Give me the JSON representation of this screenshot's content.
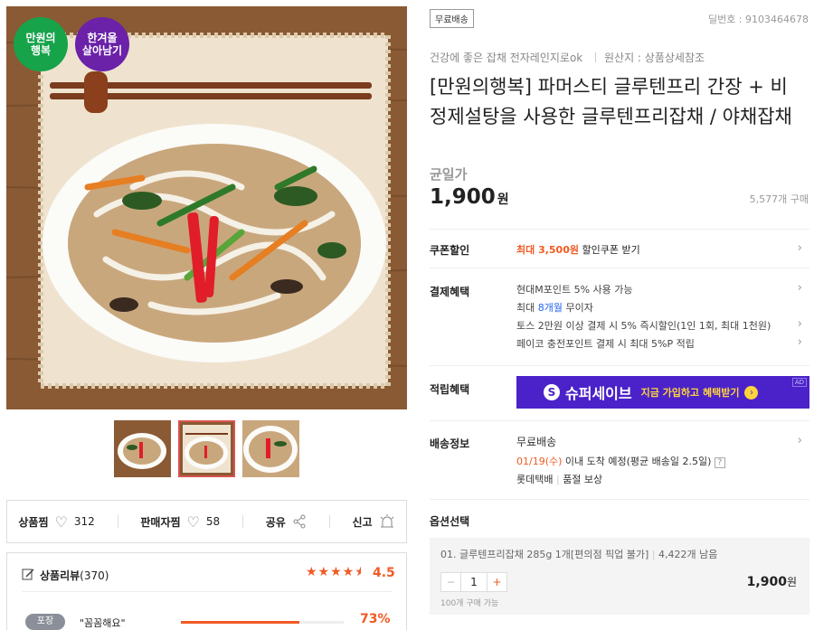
{
  "badges": {
    "happiness": "만원의\n행복",
    "winter": "한겨울\n살아남기"
  },
  "product": {
    "free_ship_tag": "무료배송",
    "product_no": "딜번호 : 9103464678",
    "subtitle": "건강에 좋은 잡채 전자레인지로ok",
    "origin": "원산지 : 상품상세참조",
    "title": "[만원의행복] 파머스티 글루텐프리 간장 + 비정제설탕을 사용한 글루텐프리잡채 / 야채잡채",
    "price_label": "균일가",
    "price": "1,900",
    "price_unit": "원",
    "sold": "5,577개 구매"
  },
  "coupon": {
    "label": "쿠폰할인",
    "highlight": "최대 3,500원",
    "text": "할인쿠폰 받기"
  },
  "payment": {
    "label": "결제혜택",
    "items": [
      {
        "text": "현대M포인트 5% 사용 가능"
      },
      {
        "pre": "최대 ",
        "hl": "8개월",
        "post": " 무이자"
      },
      {
        "text": "토스 2만원 이상 결제 시 5% 즉시할인(1인 1회, 최대 1천원)"
      },
      {
        "text": "페이코 충전포인트 결제 시 최대 5%P 적립"
      }
    ]
  },
  "rewards": {
    "label": "적립혜택",
    "banner_brand": "슈퍼세이브",
    "banner_cta": "지금 가입하고 혜택받기",
    "ad": "AD"
  },
  "shipping": {
    "label": "배송정보",
    "method": "무료배송",
    "eta_date": "01/19(수)",
    "eta_text": "이내 도착 예정(평균 배송일 2.5일)",
    "carrier": "롯데택배",
    "carrier_note": "품절 보상"
  },
  "option": {
    "label": "옵션선택",
    "name": "01. 글루텐프리잡채 285g 1개[편의점 픽업 불가]",
    "stock": "4,422개 남음",
    "qty": "1",
    "minus": "−",
    "plus": "+",
    "price": "1,900",
    "price_unit": "원",
    "limit": "100개 구매 가능"
  },
  "actions": {
    "like_label": "상품찜",
    "like_count": "312",
    "seller_label": "판매자찜",
    "seller_count": "58",
    "share_label": "공유",
    "report_label": "신고"
  },
  "review": {
    "label": "상품리뷰",
    "count": "(370)",
    "rating": "4.5",
    "tag": "포장",
    "quote": "\"꼼꼼해요\"",
    "percent": "73%",
    "fill": 0.73
  },
  "colors": {
    "accent": "#f15a24",
    "purple": "#5b2bd8",
    "green": "#16a34a",
    "badge_purple": "#6b21a8",
    "star": "#f15a24"
  }
}
